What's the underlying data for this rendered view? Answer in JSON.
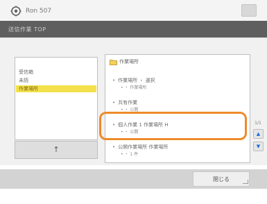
{
  "header": {
    "brand": "Ron 507",
    "logo_icon": "settings-gear-logo"
  },
  "title_bar": {
    "title": "送信作業 TOP"
  },
  "left_list": {
    "items": [
      {
        "label": "受信箱"
      },
      {
        "label": "未読"
      },
      {
        "label": "作業場所",
        "selected": true
      }
    ]
  },
  "up_button": {
    "label": "↑"
  },
  "right_list": {
    "folder": {
      "label": "作業場所",
      "icon": "folder-icon"
    },
    "entries": [
      {
        "name": "作業場所 ・ 選択",
        "sub": "・ 作業場所"
      },
      {
        "name": "共有作業",
        "sub": "・ 公開"
      },
      {
        "name": "個人作業 1 作業場所 H",
        "sub": "・ 公開"
      },
      {
        "name": "公開作業場所 作業場所",
        "sub": "・ 1 件"
      }
    ]
  },
  "scroll": {
    "page": "1/1",
    "up_icon": "triangle-up-icon",
    "down_icon": "triangle-down-icon"
  },
  "footer": {
    "close_label": "閉じる"
  },
  "colors": {
    "selection": "#f3e04a",
    "highlight": "#ee8a2a",
    "title_bar": "#5f5f5f"
  }
}
